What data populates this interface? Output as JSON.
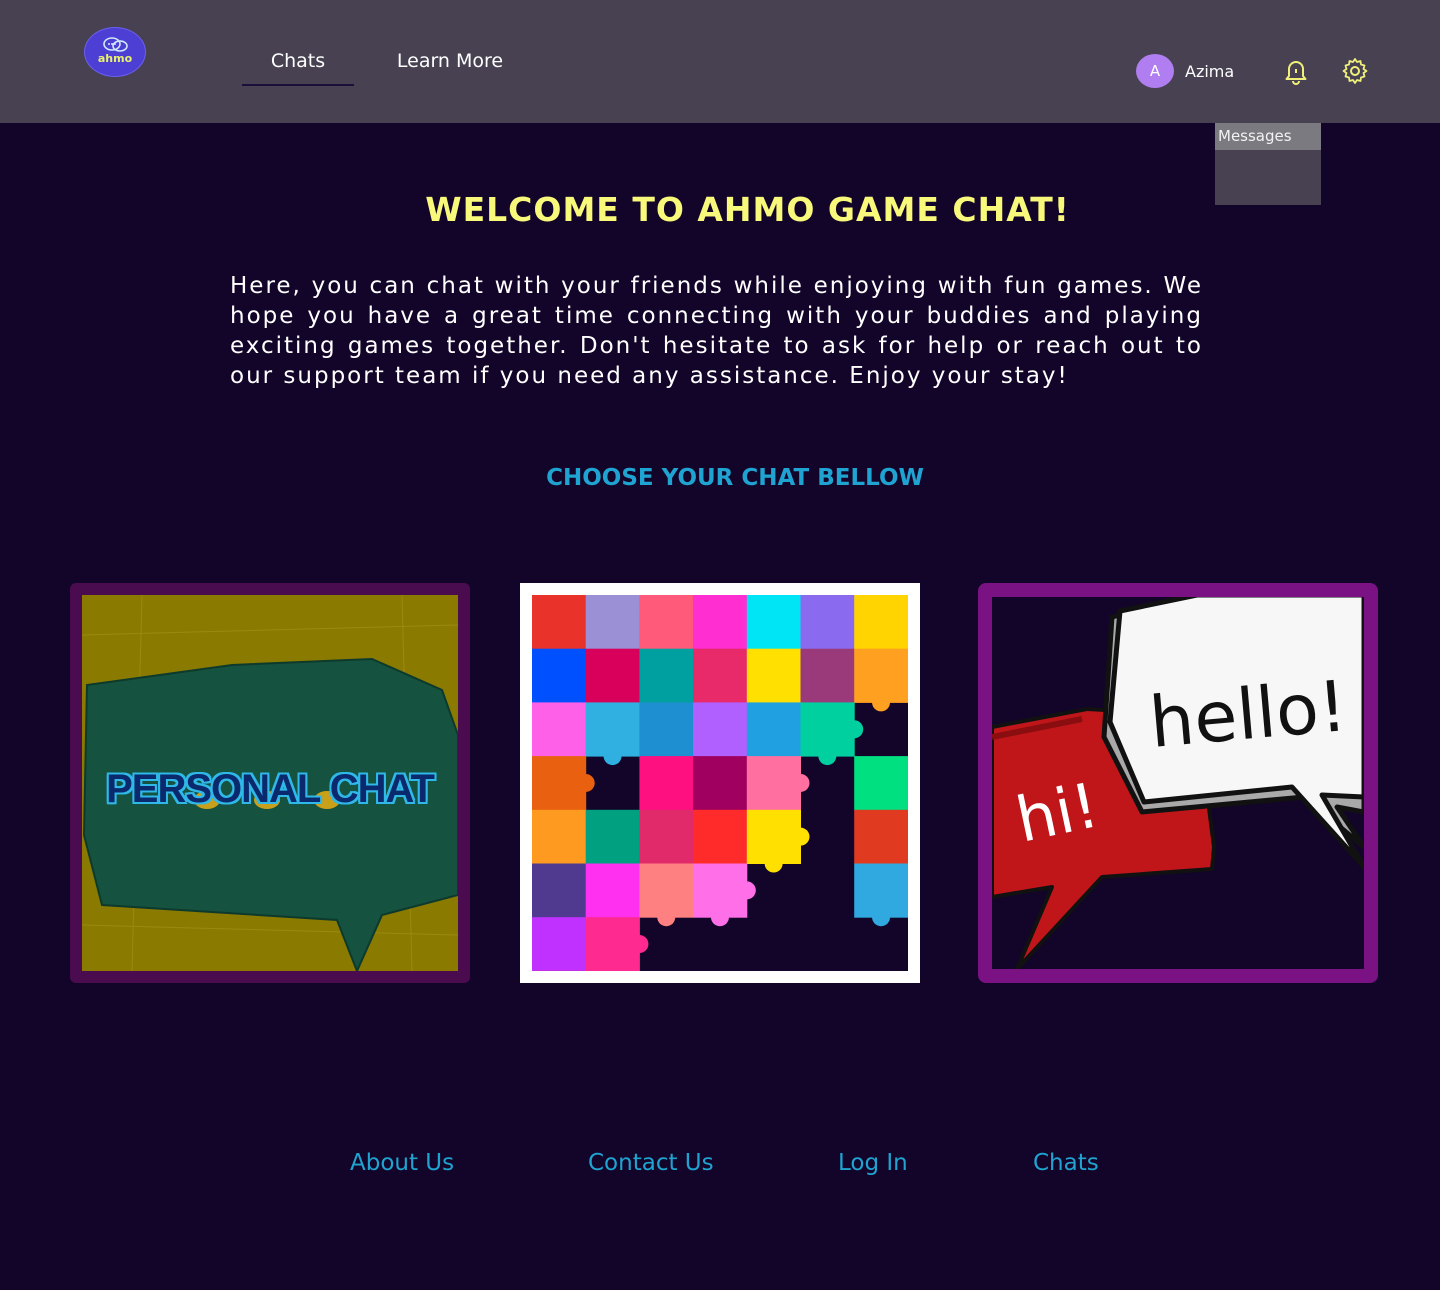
{
  "header": {
    "logo_text": "ahmo",
    "nav": [
      {
        "label": "Chats",
        "active": true
      },
      {
        "label": "Learn More",
        "active": false
      }
    ],
    "user": {
      "initial": "A",
      "name": "Azima"
    },
    "icons": [
      "bell-icon",
      "settings-gear-icon"
    ]
  },
  "messages_panel": {
    "label": "Messages"
  },
  "main": {
    "welcome_title": "WELCOME TO AHMO GAME CHAT!",
    "intro": "Here, you can chat with your friends while enjoying with fun games. We hope you have a great time connecting with your buddies and playing exciting games together. Don't hesitate to ask for help or reach out to our support team if you need any assistance. Enjoy your stay!",
    "choose_heading": "CHOOSE YOUR CHAT BELLOW",
    "cards": [
      {
        "label": "PERSONAL CHAT",
        "image": "green-speech-bubble-on-yellow"
      },
      {
        "label": "",
        "image": "colorful-puzzle-pieces"
      },
      {
        "label": "",
        "image": "hi-hello-speech-bubbles",
        "bubble_texts": [
          "hi!",
          "hello!"
        ]
      }
    ]
  },
  "footer": {
    "links": [
      "About Us",
      "Contact Us",
      "Log In",
      "Chats"
    ]
  },
  "colors": {
    "background": "#130529",
    "header": "#474152",
    "title": "#f8f87a",
    "accent": "#1fa3d1",
    "avatar": "#b07ef0"
  }
}
